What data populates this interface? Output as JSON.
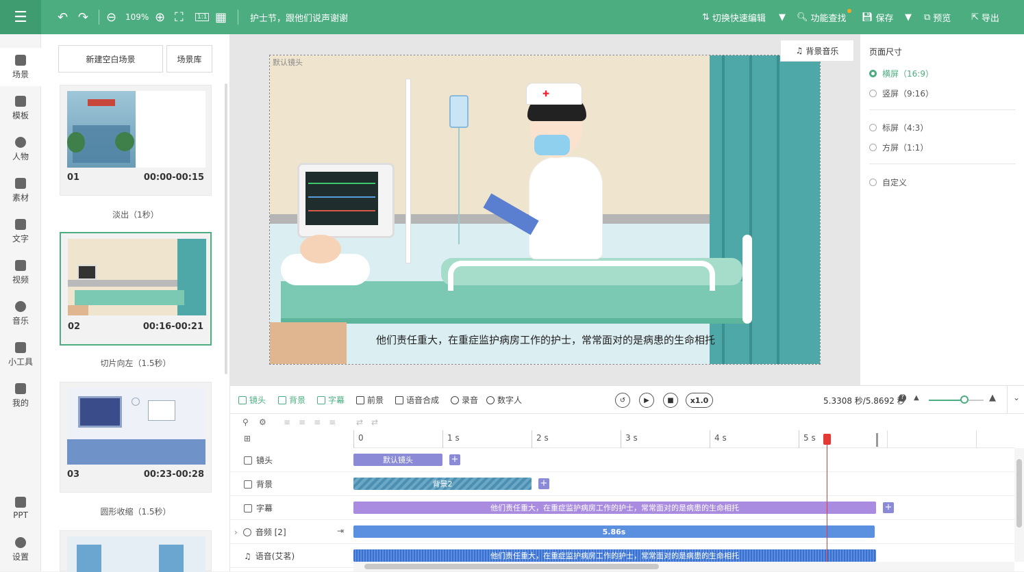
{
  "toolbar": {
    "zoom": "109%",
    "project_title": "护士节，跟他们说声谢谢",
    "switch_edit": "切换快速编辑",
    "find_feature": "功能查找",
    "save": "保存",
    "preview": "预览",
    "export": "导出"
  },
  "nav": [
    {
      "label": "场景"
    },
    {
      "label": "模板"
    },
    {
      "label": "人物"
    },
    {
      "label": "素材"
    },
    {
      "label": "文字"
    },
    {
      "label": "视频"
    },
    {
      "label": "音乐"
    },
    {
      "label": "小工具"
    },
    {
      "label": "我的"
    },
    {
      "label": "PPT"
    },
    {
      "label": "设置"
    }
  ],
  "scenes": {
    "new_blank": "新建空白场景",
    "library": "场景库",
    "items": [
      {
        "num": "01",
        "time": "00:00-00:15",
        "transition": "淡出（1秒）"
      },
      {
        "num": "02",
        "time": "00:16-00:21",
        "transition": "切片向左（1.5秒）"
      },
      {
        "num": "03",
        "time": "00:23-00:28",
        "transition": "圆形收缩（1.5秒）"
      }
    ]
  },
  "canvas": {
    "default_shot": "默认镜头",
    "bg_music": "背景音乐",
    "subtitle": "他们责任重大，在重症监护病房工作的护士，常常面对的是病患的生命相托"
  },
  "props": {
    "title": "页面尺寸",
    "options": [
      {
        "label": "横屏（16:9）",
        "selected": true
      },
      {
        "label": "竖屏（9:16）",
        "selected": false
      },
      {
        "label": "标屏（4:3）",
        "selected": false
      },
      {
        "label": "方屏（1:1）",
        "selected": false
      },
      {
        "label": "自定义",
        "selected": false
      }
    ]
  },
  "timeline": {
    "tabs": [
      "镜头",
      "背景",
      "字幕",
      "前景",
      "语音合成",
      "录音",
      "数字人"
    ],
    "speed": "x1.0",
    "time_readout": "5.3308 秒/5.8692 秒",
    "ruler": [
      "0",
      "1 s",
      "2 s",
      "3 s",
      "4 s",
      "5 s"
    ],
    "tracks": [
      {
        "label": "镜头",
        "clip": "默认镜头"
      },
      {
        "label": "背景",
        "clip": "背景2"
      },
      {
        "label": "字幕",
        "clip": "他们责任重大，在重症监护病房工作的护士，常常面对的是病患的生命相托"
      },
      {
        "label": "音频 [2]",
        "clip": "5.86s"
      },
      {
        "label": "语音(艾茗)",
        "clip": "他们责任重大，在重症监护病房工作的护士，常常面对的是病患的生命相托"
      }
    ]
  },
  "colors": {
    "brand": "#4cae80",
    "clip_purple": "#8a8ad6",
    "clip_blue": "#5b8fe0",
    "playhead": "#e53935"
  }
}
